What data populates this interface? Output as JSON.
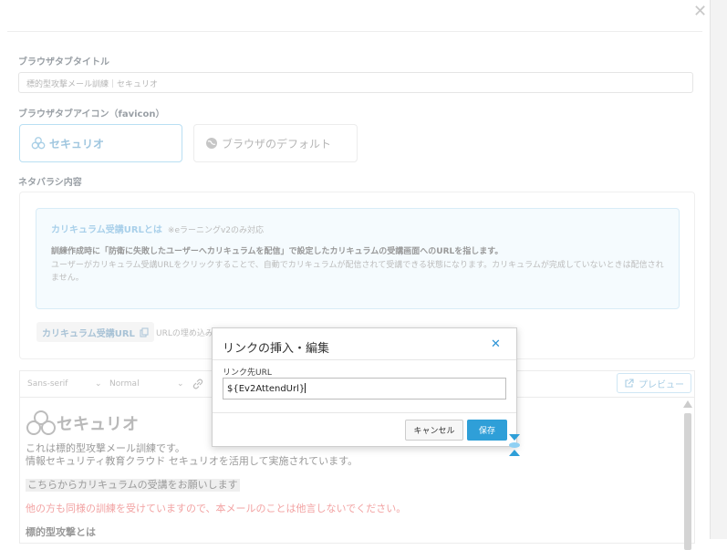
{
  "labels": {
    "tab_title": "ブラウザタブタイトル",
    "tab_icon": "ブラウザタブアイコン（favicon）",
    "reveal_content": "ネタバラシ内容"
  },
  "tab_title_value": "標的型攻撃メール訓練｜セキュリオ",
  "favicon": {
    "option1": "セキュリオ",
    "option2": "ブラウザのデフォルト"
  },
  "info": {
    "title": "カリキュラム受講URLとは",
    "note": "※eラーニングv2のみ対応",
    "body1": "訓練作成時に「防衛に失敗したユーザーへカリキュラムを配信」で設定したカリキュラムの受講画面へのURLを指します。",
    "body2": "ユーザーがカリキュラム受講URLをクリックすることで、自動でカリキュラムが配信されて受講できる状態になります。カリキュラムが完成していないときは配信されません。"
  },
  "tag": {
    "label": "カリキュラム受講URL",
    "desc": "URLの埋め込み"
  },
  "editor": {
    "font": "Sans-serif",
    "size": "Normal",
    "preview": "プレビュー",
    "logo_text": "セキュリオ",
    "lines": [
      "これは標的型攻撃メール訓練です。",
      "情報セキュリティ教育クラウド セキュリオを活用して実施されています。",
      "こちらからカリキュラムの受講をお願いします",
      "他の方も同様の訓練を受けていますので、本メールのことは他言しないでください。",
      "標的型攻撃とは"
    ]
  },
  "modal": {
    "title": "リンクの挿入・編集",
    "url_label": "リンク先URL",
    "url_value": "${Ev2AttendUrl}",
    "cancel": "キャンセル",
    "save": "保存"
  },
  "colors": {
    "accent": "#2f9fd8",
    "warning_text": "#f2a3a3"
  }
}
